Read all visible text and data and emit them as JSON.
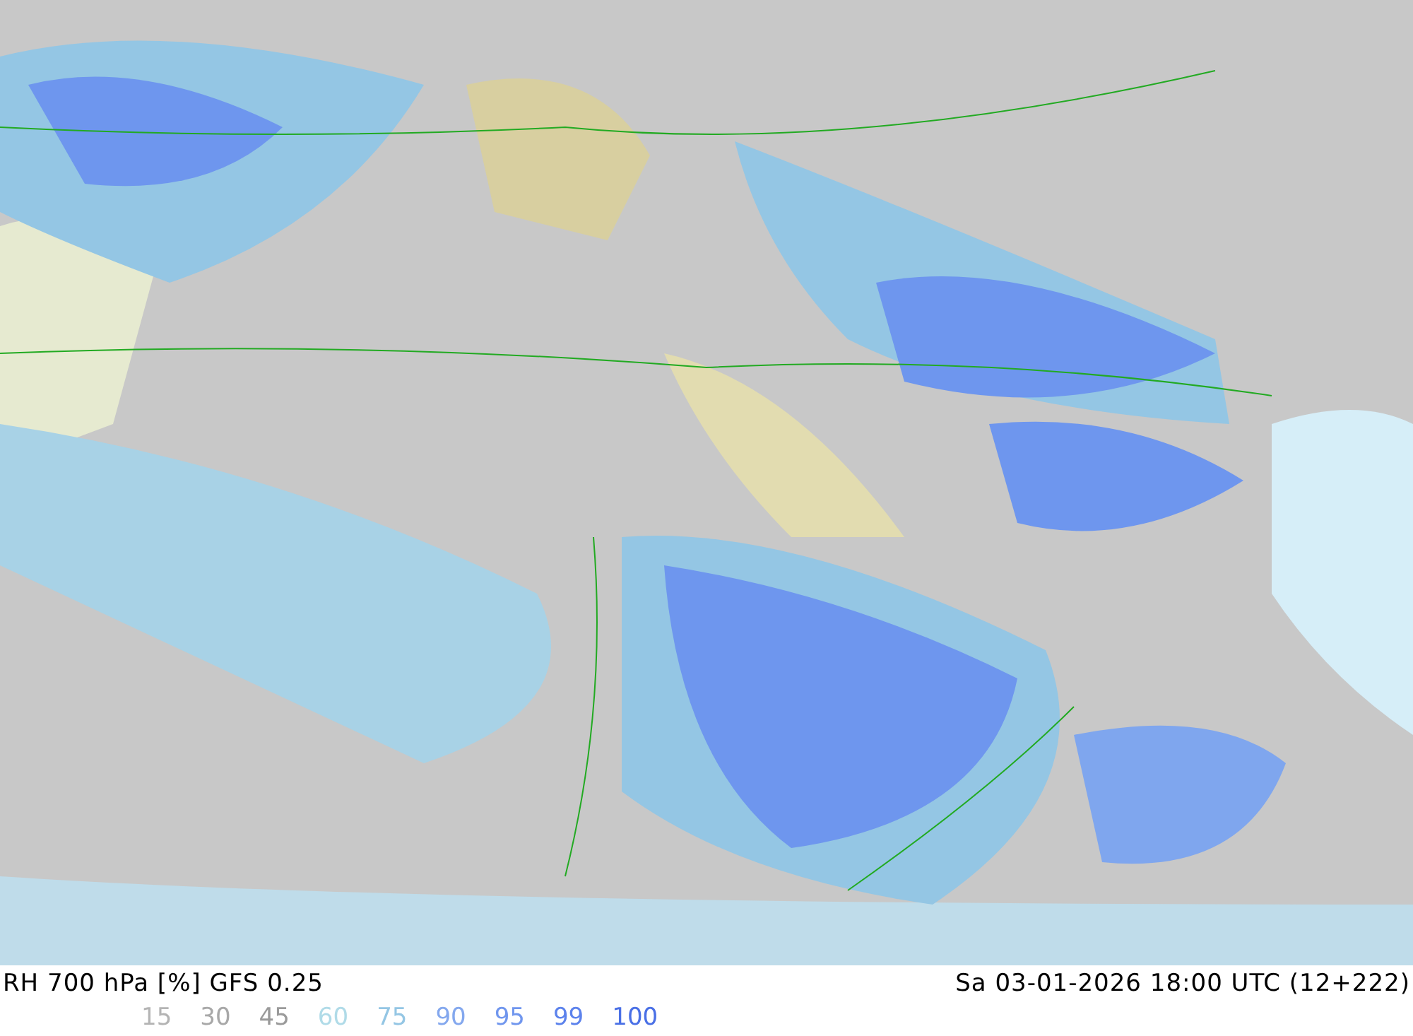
{
  "map": {
    "title": "RH 700 hPa [%] GFS 0.25",
    "timestamp": "Sa 03-01-2026 18:00 UTC (12+222)"
  },
  "legend": [
    {
      "label": "15",
      "color": "#b4b4b4"
    },
    {
      "label": "30",
      "color": "#a8a8a8"
    },
    {
      "label": "45",
      "color": "#9a9a9a"
    },
    {
      "label": "60",
      "color": "#b0dbe8"
    },
    {
      "label": "75",
      "color": "#94c6e4"
    },
    {
      "label": "90",
      "color": "#84a8ee"
    },
    {
      "label": "95",
      "color": "#7096ee"
    },
    {
      "label": "99",
      "color": "#5c82ec"
    },
    {
      "label": "100",
      "color": "#4a70e6"
    }
  ]
}
